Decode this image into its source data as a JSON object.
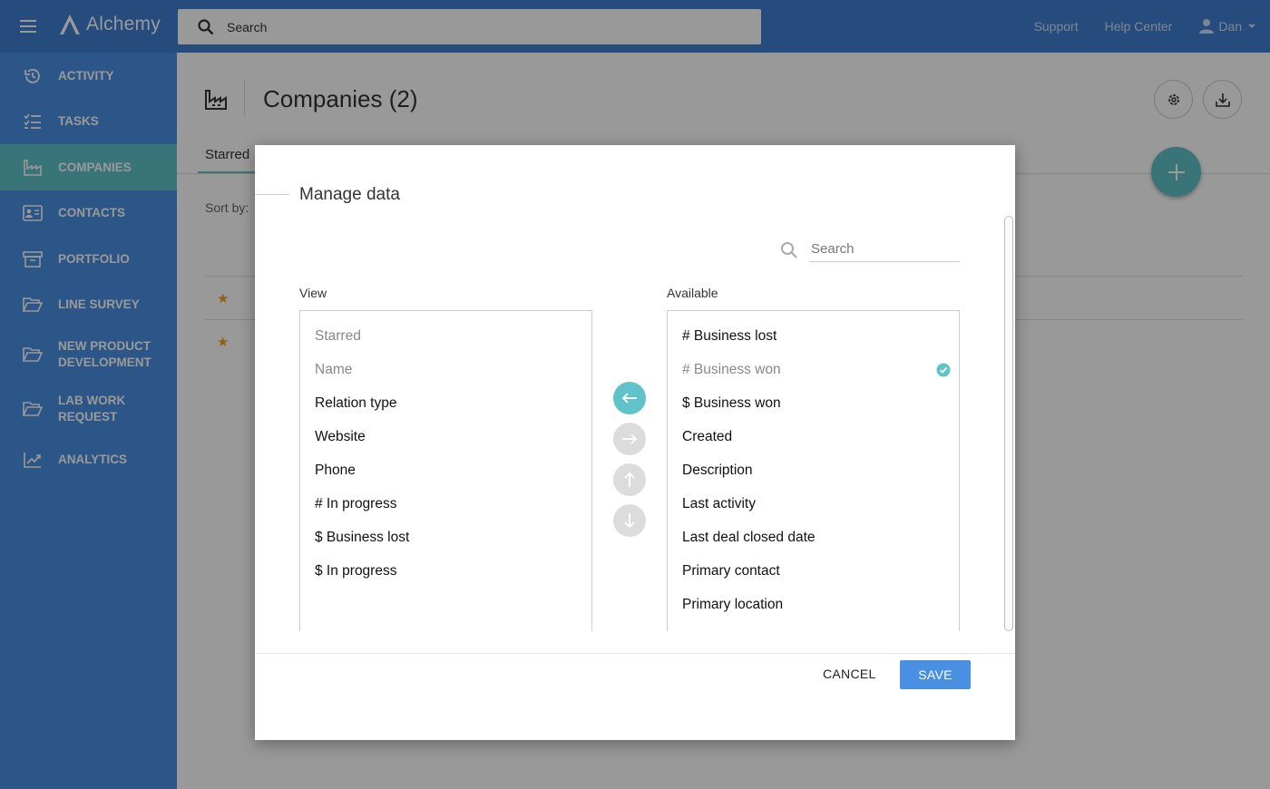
{
  "app": {
    "name": "Alchemy"
  },
  "topbar": {
    "search_placeholder": "Search",
    "links": [
      "Support",
      "Help Center"
    ],
    "user_name": "Dan"
  },
  "sidebar": {
    "items": [
      {
        "label": "ACTIVITY",
        "icon": "history-icon"
      },
      {
        "label": "TASKS",
        "icon": "checklist-icon"
      },
      {
        "label": "COMPANIES",
        "icon": "factory-icon",
        "active": true
      },
      {
        "label": "CONTACTS",
        "icon": "contact-card-icon"
      },
      {
        "label": "PORTFOLIO",
        "icon": "archive-icon"
      },
      {
        "label": "LINE SURVEY",
        "icon": "folder-open-icon"
      },
      {
        "label": "NEW PRODUCT\nDEVELOPMENT",
        "icon": "folder-open-icon"
      },
      {
        "label": "LAB WORK\nREQUEST",
        "icon": "folder-open-icon"
      },
      {
        "label": "ANALYTICS",
        "icon": "trending-up-icon"
      }
    ]
  },
  "page": {
    "title": "Companies (2)",
    "tab": "Starred",
    "sort_label": "Sort by:"
  },
  "modal": {
    "title": "Manage data",
    "search_placeholder": "Search",
    "view_label": "View",
    "available_label": "Available",
    "view_items": [
      {
        "label": "Starred",
        "muted": true
      },
      {
        "label": "Name",
        "muted": true
      },
      {
        "label": "Relation type"
      },
      {
        "label": "Website"
      },
      {
        "label": "Phone"
      },
      {
        "label": "# In progress"
      },
      {
        "label": "$ Business lost"
      },
      {
        "label": "$ In progress"
      }
    ],
    "available_items": [
      {
        "label": "# Business lost"
      },
      {
        "label": "# Business won",
        "muted": true,
        "selected": true
      },
      {
        "label": "$ Business won"
      },
      {
        "label": "Created"
      },
      {
        "label": "Description"
      },
      {
        "label": "Last activity"
      },
      {
        "label": "Last deal closed date"
      },
      {
        "label": "Primary contact"
      },
      {
        "label": "Primary location"
      }
    ],
    "cancel_label": "CANCEL",
    "save_label": "SAVE"
  },
  "colors": {
    "accent": "#5fc3c9",
    "primary": "#4a90e2"
  }
}
